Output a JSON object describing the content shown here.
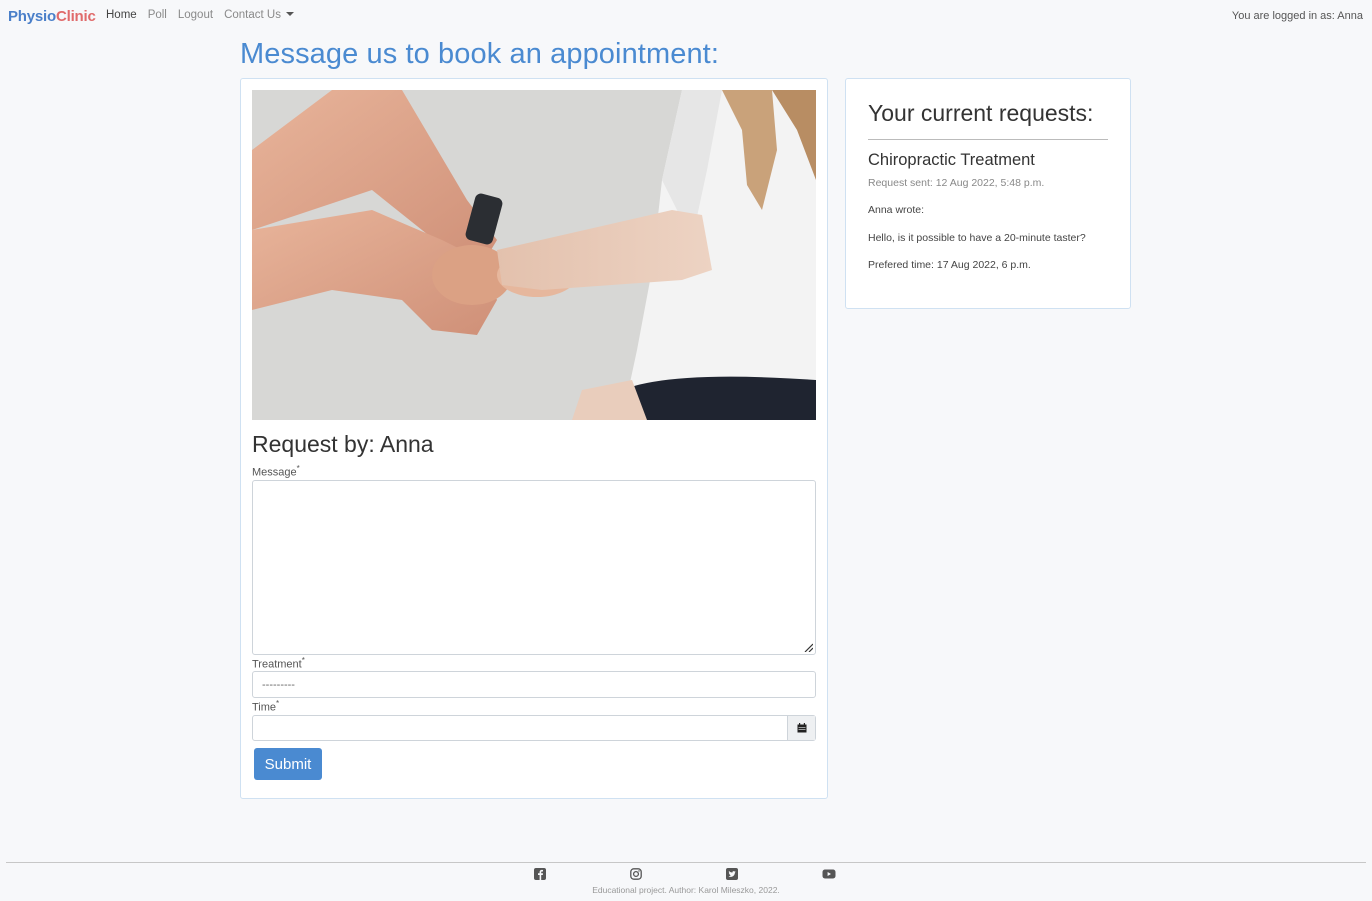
{
  "nav": {
    "brand_part1": "Physio",
    "brand_part2": "Clinic",
    "links": [
      "Home",
      "Poll",
      "Logout",
      "Contact Us"
    ],
    "logged_in": "You are logged in as: Anna"
  },
  "page": {
    "title": "Message us to book an appointment:"
  },
  "form": {
    "request_by": "Request by: Anna",
    "message_label": "Message",
    "treatment_label": "Treatment",
    "treatment_value": "---------",
    "time_label": "Time",
    "required_mark": "*",
    "submit_label": "Submit"
  },
  "requests": {
    "title": "Your current requests:",
    "items": [
      {
        "treatment": "Chiropractic Treatment",
        "sent": "Request sent: 12 Aug 2022, 5:48 p.m.",
        "author": "Anna wrote:",
        "message": "Hello, is it possible to have a 20-minute taster?",
        "preferred": "Prefered time: 17 Aug 2022, 6 p.m."
      }
    ]
  },
  "footer": {
    "icons": [
      "facebook-icon",
      "instagram-icon",
      "twitter-icon",
      "youtube-icon"
    ],
    "text": "Educational project. Author: Karol Mileszko, 2022."
  },
  "colors": {
    "accent": "#4a8ad1",
    "brand_red": "#e06b6b"
  }
}
